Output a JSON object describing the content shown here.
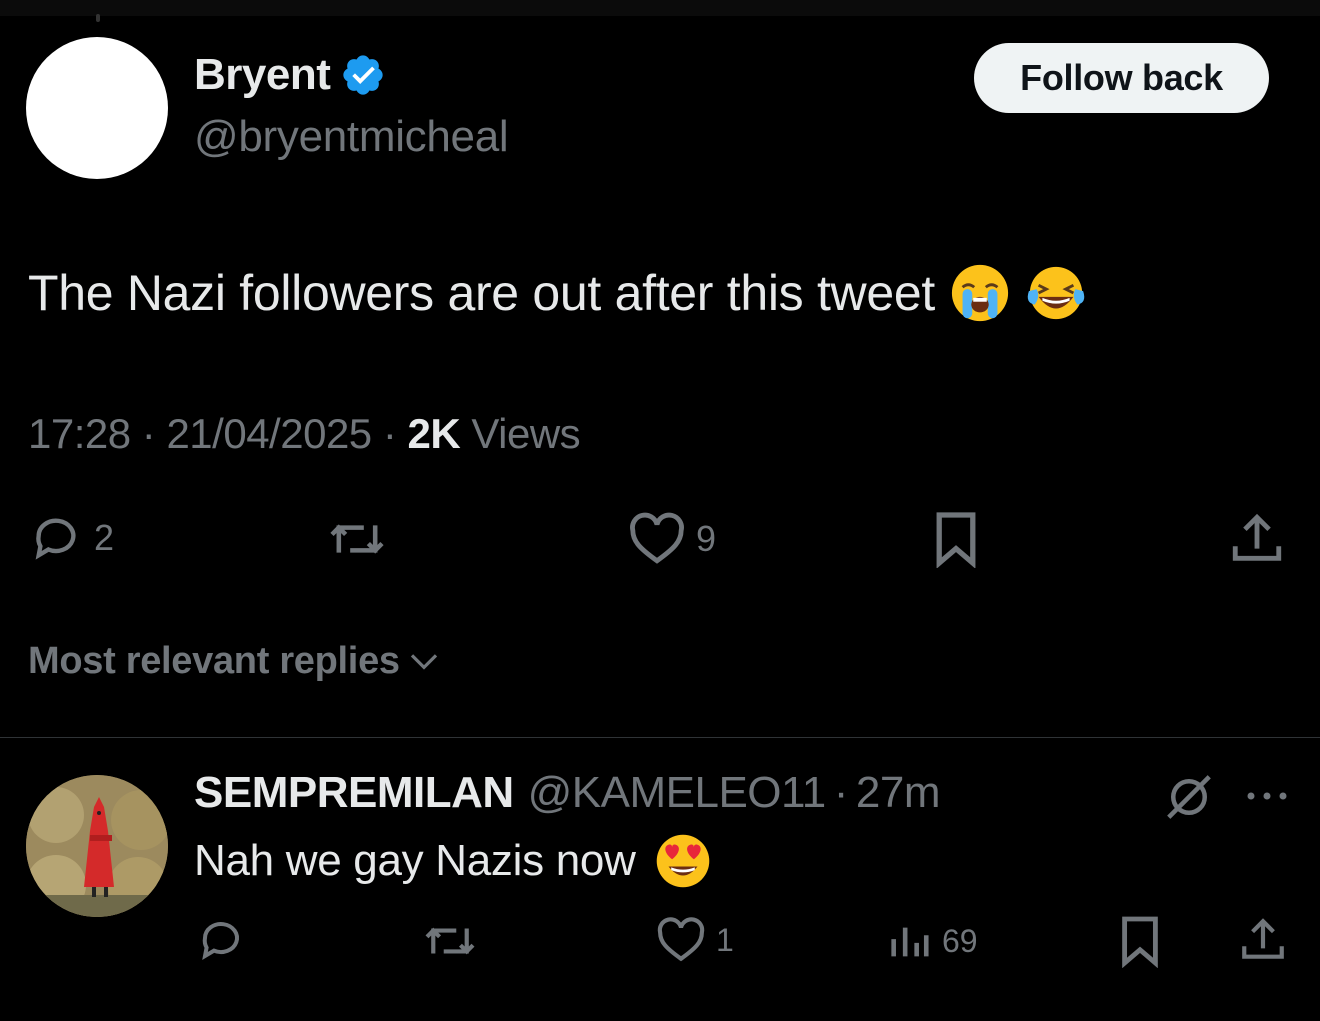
{
  "author": {
    "name": "Bryent",
    "handle": "@bryentmicheal",
    "verified": true
  },
  "follow_button": {
    "label": "Follow back"
  },
  "tweet": {
    "text": "The Nazi followers are out after this tweet",
    "emojis": [
      "loudly-crying-face",
      "face-with-tears-of-joy"
    ],
    "time": "17:28",
    "date": "21/04/2025",
    "views_count": "2K",
    "views_label": "Views",
    "separator": "·",
    "actions": {
      "replies": "2",
      "reposts": "",
      "likes": "9"
    }
  },
  "replies_sort": {
    "label": "Most relevant replies"
  },
  "reply": {
    "name": "SEMPREMILAN",
    "handle": "@KAMELEO11",
    "time": "27m",
    "text": "Nah we gay Nazis now",
    "emoji": "smiling-face-with-heart-eyes",
    "actions": {
      "replies": "",
      "reposts": "",
      "likes": "1",
      "views": "69"
    }
  },
  "colors": {
    "background": "#000000",
    "text_primary": "#e7e9ea",
    "text_secondary": "#71767b",
    "verified_blue": "#1d9bf0",
    "button_bg": "#eff3f4",
    "divider": "#2f3336"
  }
}
